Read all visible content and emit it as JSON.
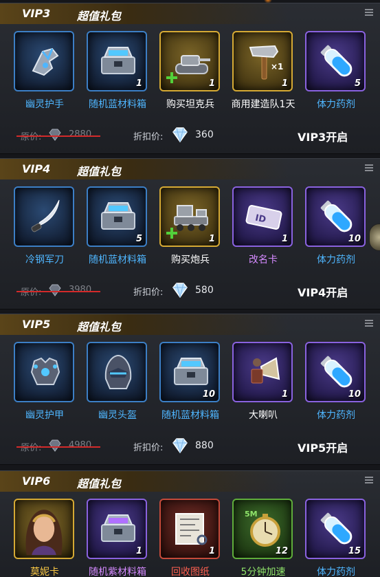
{
  "packs": [
    {
      "vip": "VIP3",
      "title": "超值礼包",
      "original_label": "原价:",
      "original_price": "2880",
      "discount_label": "折扣价:",
      "discount_price": "360",
      "unlock_text": "VIP3开启",
      "items": [
        {
          "name": "幽灵护手",
          "count": "",
          "rarity": "blue",
          "icon": "gauntlet-icon"
        },
        {
          "name": "随机蓝材料箱",
          "count": "1",
          "rarity": "blue",
          "icon": "blue-material-box-icon"
        },
        {
          "name": "购买坦克兵",
          "count": "1",
          "rarity": "gold",
          "icon": "tank-icon"
        },
        {
          "name": "商用建造队1天",
          "count": "1",
          "rarity": "gold",
          "icon": "hammer-icon"
        },
        {
          "name": "体力药剂",
          "count": "5",
          "rarity": "purple",
          "icon": "potion-icon"
        }
      ]
    },
    {
      "vip": "VIP4",
      "title": "超值礼包",
      "original_label": "原价:",
      "original_price": "3980",
      "discount_label": "折扣价:",
      "discount_price": "580",
      "unlock_text": "VIP4开启",
      "items": [
        {
          "name": "冷钢军刀",
          "count": "",
          "rarity": "blue",
          "icon": "sabre-icon"
        },
        {
          "name": "随机蓝材料箱",
          "count": "5",
          "rarity": "blue",
          "icon": "blue-material-box-icon"
        },
        {
          "name": "购买炮兵",
          "count": "1",
          "rarity": "gold",
          "icon": "artillery-truck-icon"
        },
        {
          "name": "改名卡",
          "count": "1",
          "rarity": "purple",
          "icon": "id-card-icon"
        },
        {
          "name": "体力药剂",
          "count": "10",
          "rarity": "purple",
          "icon": "potion-icon"
        }
      ]
    },
    {
      "vip": "VIP5",
      "title": "超值礼包",
      "original_label": "原价:",
      "original_price": "4980",
      "discount_label": "折扣价:",
      "discount_price": "880",
      "unlock_text": "VIP5开启",
      "items": [
        {
          "name": "幽灵护甲",
          "count": "",
          "rarity": "blue",
          "icon": "armor-icon"
        },
        {
          "name": "幽灵头盔",
          "count": "",
          "rarity": "blue",
          "icon": "helmet-icon"
        },
        {
          "name": "随机蓝材料箱",
          "count": "10",
          "rarity": "blue",
          "icon": "blue-material-box-icon"
        },
        {
          "name": "大喇叭",
          "count": "1",
          "rarity": "purple",
          "icon": "megaphone-icon"
        },
        {
          "name": "体力药剂",
          "count": "10",
          "rarity": "purple",
          "icon": "potion-icon"
        }
      ]
    },
    {
      "vip": "VIP6",
      "title": "超值礼包",
      "items": [
        {
          "name": "莫妮卡",
          "count": "",
          "rarity": "gold",
          "icon": "hero-portrait-icon"
        },
        {
          "name": "随机紫材料箱",
          "count": "1",
          "rarity": "purple",
          "icon": "purple-material-box-icon"
        },
        {
          "name": "回收图纸",
          "count": "1",
          "rarity": "red",
          "icon": "blueprint-icon"
        },
        {
          "name": "5分钟加速",
          "count": "12",
          "rarity": "green",
          "icon": "stopwatch-icon",
          "badge": "5M"
        },
        {
          "name": "体力药剂",
          "count": "15",
          "rarity": "purple",
          "icon": "potion-icon"
        }
      ]
    }
  ]
}
